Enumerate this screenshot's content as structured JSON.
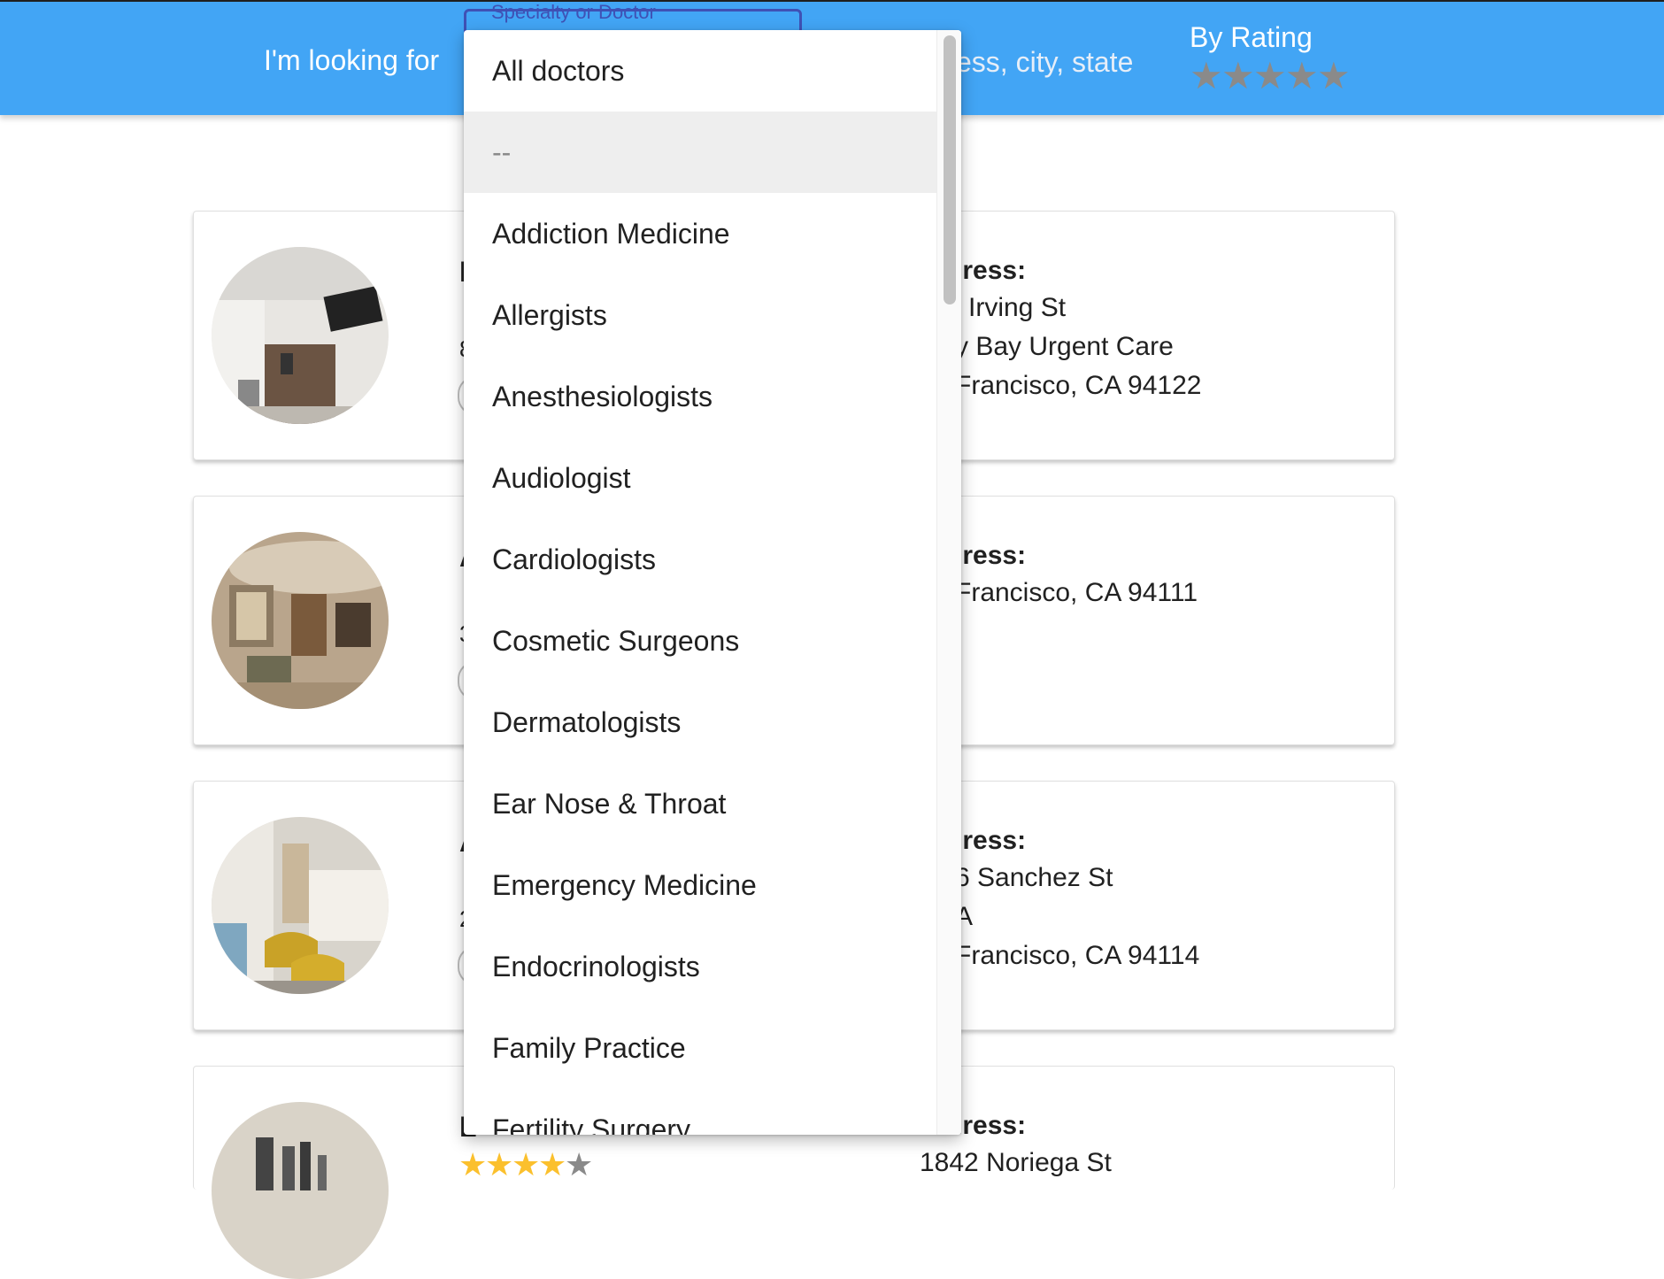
{
  "header": {
    "looking_for_label": "I'm looking for",
    "specialty_label": "Specialty or Doctor",
    "location_placeholder": "ess, city, state",
    "rating_label": "By Rating",
    "rating_star_glyph": "★",
    "rating_value_stars": 0
  },
  "dropdown": {
    "options": [
      "All doctors",
      "--",
      "Addiction Medicine",
      "Allergists",
      "Anesthesiologists",
      "Audiologist",
      "Cardiologists",
      "Cosmetic Surgeons",
      "Dermatologists",
      "Ear Nose & Throat",
      "Emergency Medicine",
      "Endocrinologists",
      "Family Practice",
      "Fertility Surgery"
    ],
    "highlighted_option": "--"
  },
  "results": [
    {
      "name_fragment": "I",
      "count_fragment": "8",
      "address_label": "lress:",
      "address_lines": [
        "l Irving St",
        "y Bay Urgent Care",
        " Francisco, CA 94122"
      ]
    },
    {
      "name_fragment": "A",
      "count_fragment": "3",
      "address_label": "lress:",
      "address_lines": [
        " Francisco, CA 94111"
      ]
    },
    {
      "name_fragment": "A",
      "count_fragment": "2",
      "address_label": "lress:",
      "address_lines": [
        "6 Sanchez St",
        "A",
        " Francisco, CA 94114"
      ]
    },
    {
      "name_fragment": "L",
      "count_fragment": "",
      "address_label": "lress:",
      "address_lines": [
        "1842 Noriega St"
      ],
      "rating_stars": 4
    }
  ],
  "colors": {
    "header_bg": "#42a5f5",
    "select_outline": "#3f51b5",
    "star_filled": "#fbc02d",
    "star_empty": "#8a8a8a"
  }
}
